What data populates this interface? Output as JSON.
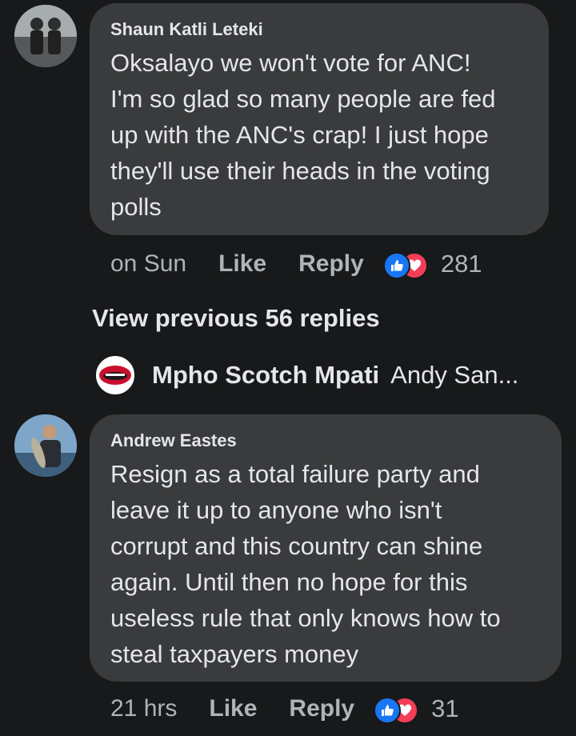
{
  "comments": [
    {
      "author": "Shaun Katli Leteki",
      "text_lines": [
        "Oksalayo we won't vote for ANC!",
        "I'm so glad so many people are fed",
        "up with the ANC's crap! I just hope",
        "they'll use their heads in the voting",
        "polls"
      ],
      "time": "on Sun",
      "like_label": "Like",
      "reply_label": "Reply",
      "reaction_icons": [
        "like-icon",
        "love-icon"
      ],
      "reaction_count": "281"
    },
    {
      "author": "Andrew Eastes",
      "text_lines": [
        "Resign as a total failure party and",
        "leave it up to anyone who isn't",
        "corrupt and this country can shine",
        "again. Until then no hope for this",
        "useless rule that only knows how to",
        "steal taxpayers money"
      ],
      "time": "21 hrs",
      "like_label": "Like",
      "reply_label": "Reply",
      "reaction_icons": [
        "like-icon",
        "love-icon"
      ],
      "reaction_count": "31"
    }
  ],
  "view_previous": "View previous 56 replies",
  "reply_preview": {
    "name": "Mpho Scotch Mpati",
    "text": "Andy San..."
  },
  "colors": {
    "background": "#18191a",
    "bubble": "#3a3b3c",
    "text_primary": "#e4e6eb",
    "text_secondary": "#b0b3b8",
    "like_blue": "#1877f2",
    "love_red": "#f33e58"
  }
}
